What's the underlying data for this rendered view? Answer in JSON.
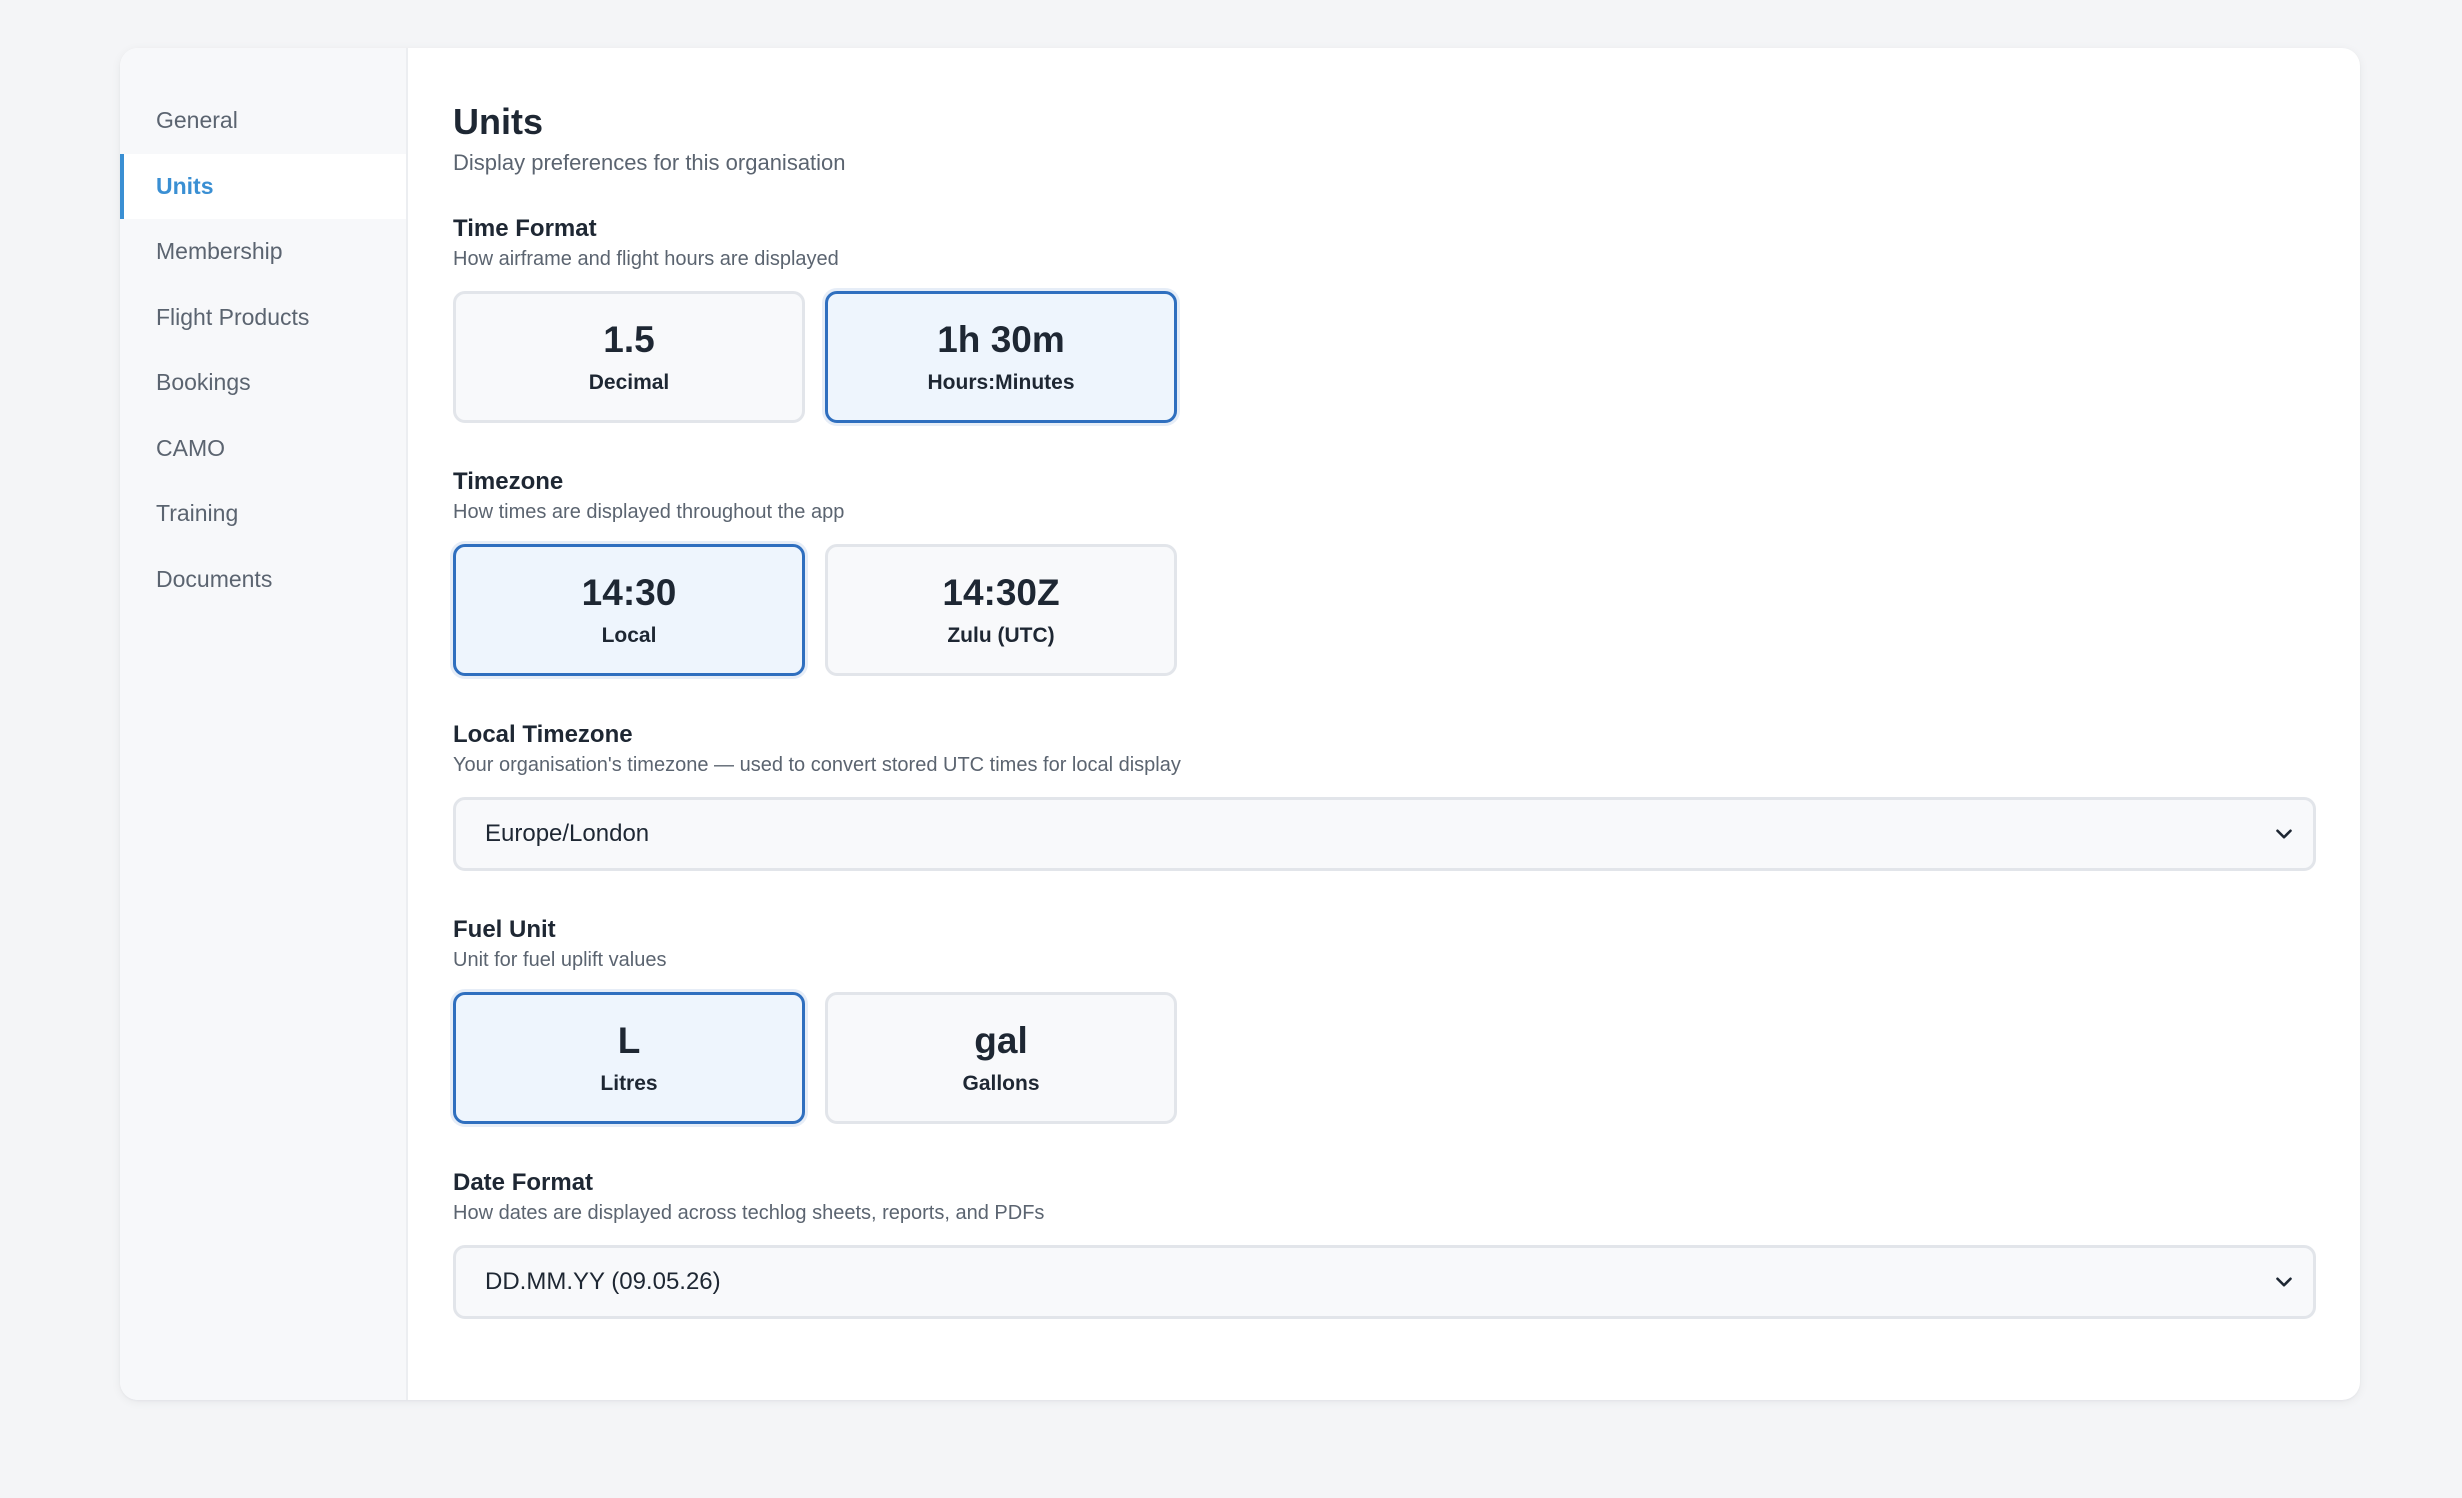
{
  "sidebar": {
    "items": [
      {
        "label": "General"
      },
      {
        "label": "Units"
      },
      {
        "label": "Membership"
      },
      {
        "label": "Flight Products"
      },
      {
        "label": "Bookings"
      },
      {
        "label": "CAMO"
      },
      {
        "label": "Training"
      },
      {
        "label": "Documents"
      }
    ],
    "active": "Units"
  },
  "page": {
    "title": "Units",
    "subtitle": "Display preferences for this organisation"
  },
  "time_format": {
    "title": "Time Format",
    "description": "How airframe and flight hours are displayed",
    "options": [
      {
        "value": "1.5",
        "label": "Decimal",
        "selected": false
      },
      {
        "value": "1h 30m",
        "label": "Hours:Minutes",
        "selected": true
      }
    ]
  },
  "timezone": {
    "title": "Timezone",
    "description": "How times are displayed throughout the app",
    "options": [
      {
        "value": "14:30",
        "label": "Local",
        "selected": true
      },
      {
        "value": "14:30Z",
        "label": "Zulu (UTC)",
        "selected": false
      }
    ]
  },
  "local_timezone": {
    "title": "Local Timezone",
    "description": "Your organisation's timezone — used to convert stored UTC times for local display",
    "selected": "Europe/London",
    "icon": "chevron-down-icon"
  },
  "fuel_unit": {
    "title": "Fuel Unit",
    "description": "Unit for fuel uplift values",
    "options": [
      {
        "value": "L",
        "label": "Litres",
        "selected": true
      },
      {
        "value": "gal",
        "label": "Gallons",
        "selected": false
      }
    ]
  },
  "date_format": {
    "title": "Date Format",
    "description": "How dates are displayed across techlog sheets, reports, and PDFs",
    "selected": "DD.MM.YY (09.05.26)",
    "icon": "chevron-down-icon"
  },
  "colors": {
    "accent": "#3a8fd3",
    "selected_border": "#2f6fbf",
    "selected_bg": "#eef5fd"
  }
}
